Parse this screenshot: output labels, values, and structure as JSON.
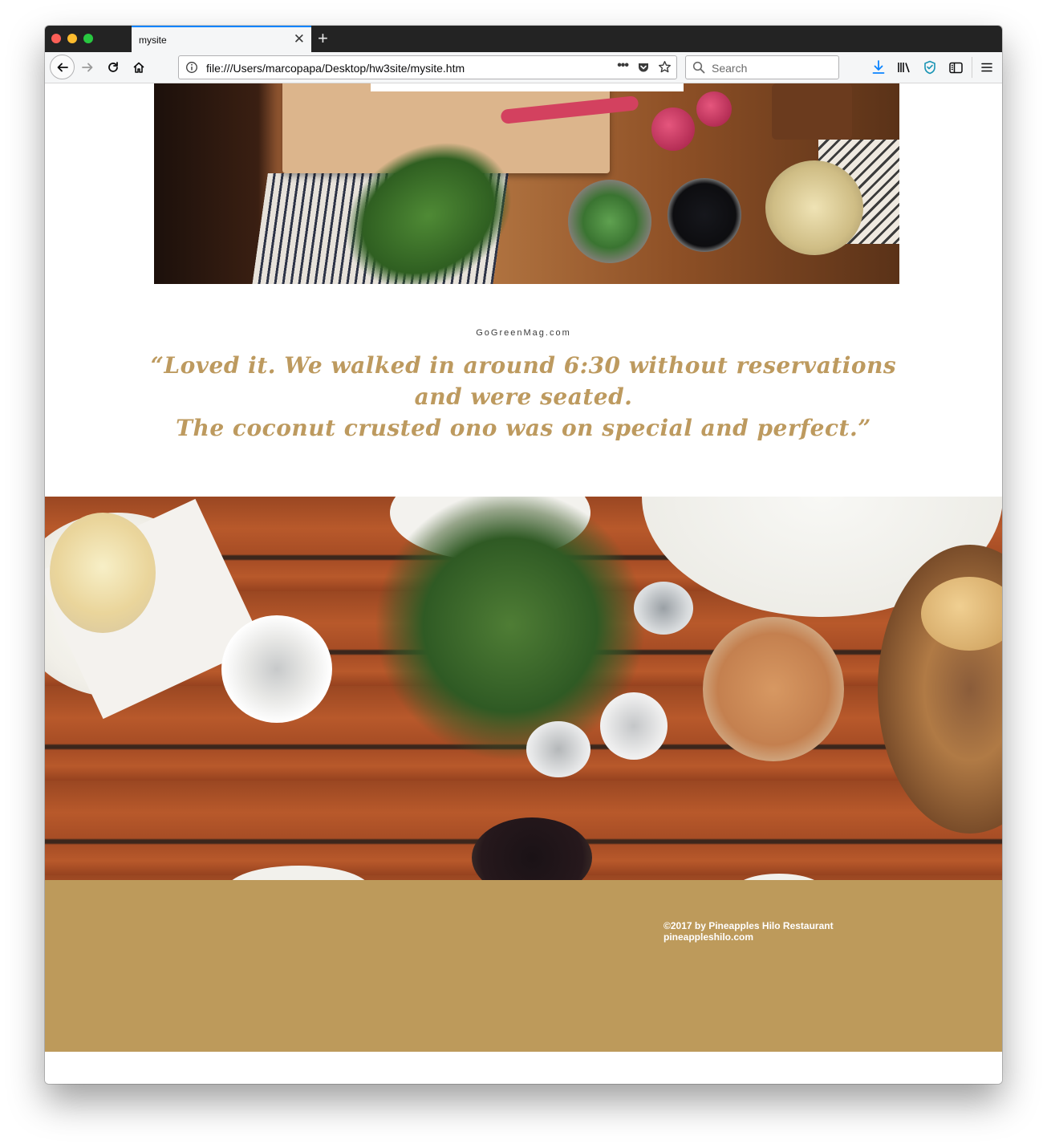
{
  "browser": {
    "tab_title": "mysite",
    "tab_close": "✕",
    "new_tab": "+",
    "url": "file:///Users/marcopapa/Desktop/hw3site/mysite.htm",
    "url_more": "•••",
    "search_placeholder": "Search",
    "accent_color": "#0a84ff"
  },
  "review": {
    "source": "GoGreenMag.com",
    "quote_lines": [
      "“Loved it. We walked in around 6:30 without reservations",
      "and were seated.",
      "The coconut crusted ono was on special and perfect.”"
    ],
    "color": "#bd9a5f"
  },
  "footer": {
    "copyright": "©2017 by Pineapples Hilo Restaurant",
    "site": "pineappleshilo.com",
    "background": "#bd9a5b"
  },
  "icons": {
    "back": "back-arrow-icon",
    "forward": "forward-arrow-icon",
    "reload": "reload-icon",
    "home": "home-icon",
    "info": "info-icon",
    "pocket": "pocket-icon",
    "bookmark": "star-icon",
    "search": "search-icon",
    "download": "download-icon",
    "library": "library-icon",
    "tracking": "shield-icon",
    "sidebar": "sidebar-icon",
    "menu": "hamburger-menu-icon"
  }
}
